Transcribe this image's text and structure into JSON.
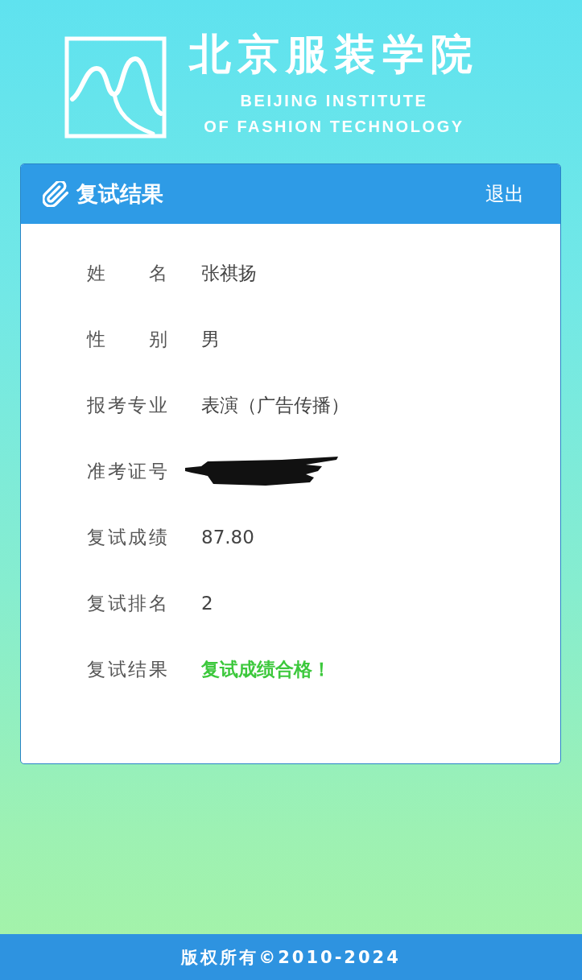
{
  "header": {
    "title": "北京服装学院",
    "subtitle_lines": [
      "BEIJING INSTITUTE",
      "OF FASHION TECHNOLOGY"
    ]
  },
  "card": {
    "title": "复试结果",
    "logout": "退出",
    "rows": [
      {
        "kind": "text",
        "label": "姓 名",
        "value": "张祺扬"
      },
      {
        "kind": "text",
        "label": "性 别",
        "value": "男"
      },
      {
        "kind": "text",
        "label": "报考专业",
        "value": "表演（广告传播）"
      },
      {
        "kind": "redacted",
        "label": "准考证号"
      },
      {
        "kind": "text",
        "label": "复试成绩",
        "value": "87.80"
      },
      {
        "kind": "text",
        "label": "复试排名",
        "value": "2"
      },
      {
        "kind": "status",
        "label": "复试结果",
        "value": "复试成绩合格！"
      }
    ]
  },
  "footer": {
    "copyright": "版权所有©2010-2024"
  }
}
